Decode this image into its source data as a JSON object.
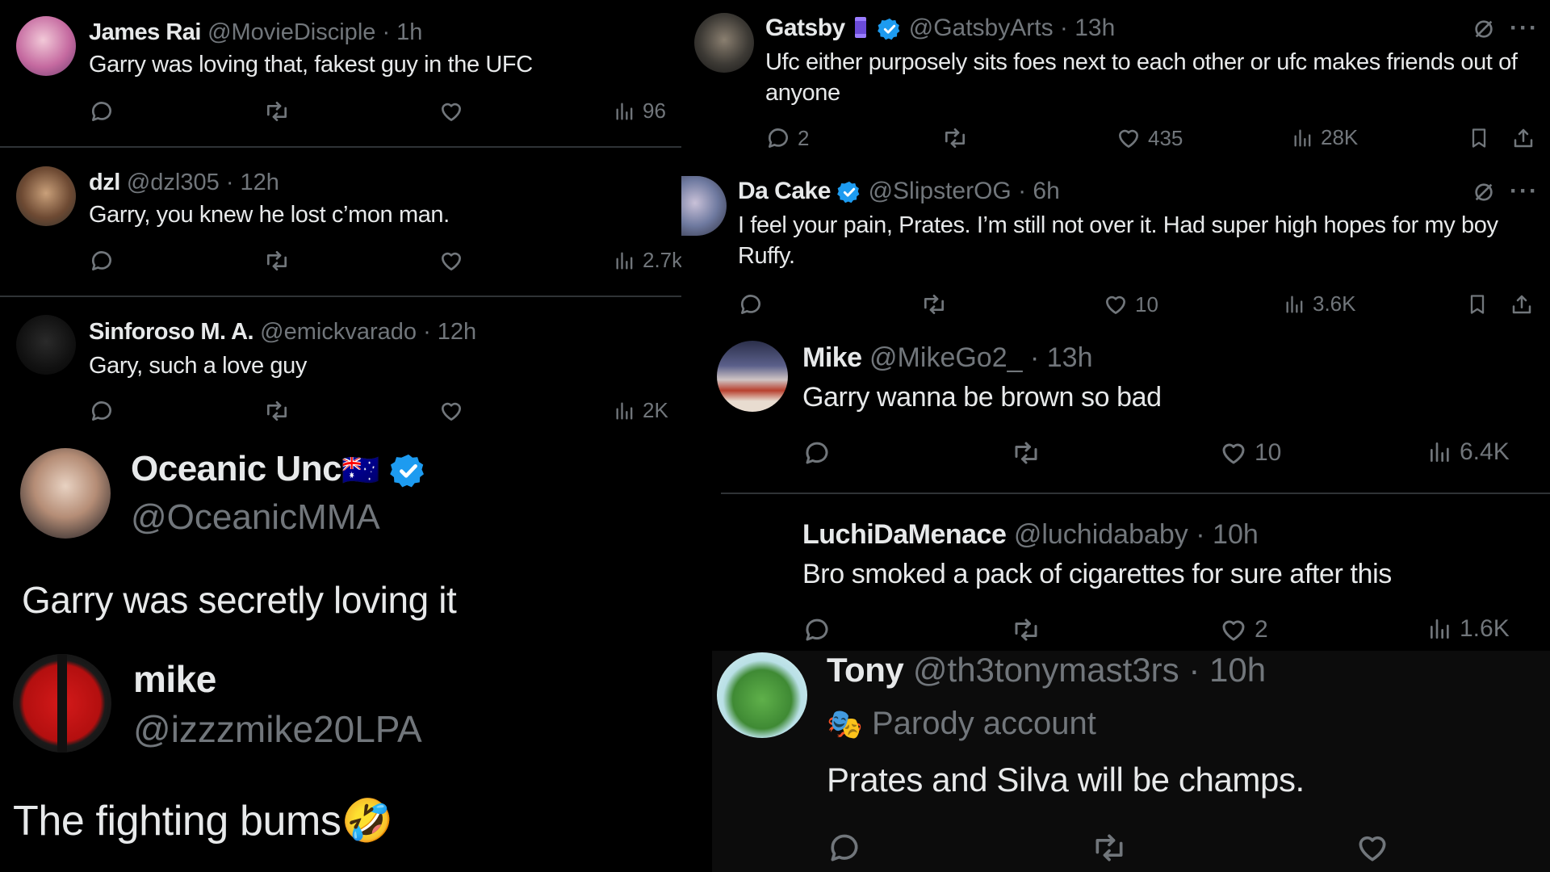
{
  "left": {
    "tweets": [
      {
        "name": "James Rai",
        "handle": "@MovieDisciple",
        "time": "· 1h",
        "text": "Garry was loving that, fakest guy in the UFC",
        "views": "96"
      },
      {
        "name": "dzl",
        "handle": "@dzl305",
        "time": "· 12h",
        "text": "Garry, you knew he lost c’mon man.",
        "views": "2.7k"
      },
      {
        "name": "Sinforoso M. A.",
        "handle": "@emickvarado",
        "time": "· 12h",
        "text": "Gary, such a love guy",
        "views": "2K"
      }
    ],
    "oceanic": {
      "name": "Oceanic Unc",
      "flag": "🇦🇺",
      "handle": "@OceanicMMA",
      "text": "Garry was secretly loving it"
    },
    "mike": {
      "name": "mike",
      "handle": "@izzzmike20LPA",
      "text": "The fighting bums",
      "emoji": "🤣"
    }
  },
  "right": {
    "gatsby": {
      "name": "Gatsby",
      "handle": "@GatsbyArts",
      "time": "· 13h",
      "text": "Ufc either purposely sits foes next to each other or ufc makes friends out of anyone",
      "replies": "2",
      "likes": "435",
      "views": "28K"
    },
    "dacake": {
      "name": "Da Cake",
      "handle": "@SlipsterOG",
      "time": "· 6h",
      "text": "I feel your pain, Prates. I’m still not over it. Had super high hopes for my boy Ruffy.",
      "likes": "10",
      "views": "3.6K"
    },
    "mike2": {
      "name": "Mike",
      "handle": "@MikeGo2_",
      "time": "· 13h",
      "text": "Garry wanna be brown so bad",
      "likes": "10",
      "views": "6.4K"
    },
    "luchi": {
      "name": "LuchiDaMenace",
      "handle": "@luchidababy",
      "time": "· 10h",
      "text": "Bro smoked a pack of cigarettes for sure after this",
      "likes": "2",
      "views": "1.6K"
    },
    "tony": {
      "name": "Tony",
      "handle": "@th3tonymast3rs",
      "time": "· 10h",
      "badge": "Parody account",
      "text": "Prates and Silva will be champs."
    }
  },
  "icons": {
    "more": "···"
  },
  "colors": {
    "background": "#000000",
    "text": "#e7e9ea",
    "muted": "#71767b",
    "verified": "#1d9bf0",
    "divider": "#2f3336"
  }
}
